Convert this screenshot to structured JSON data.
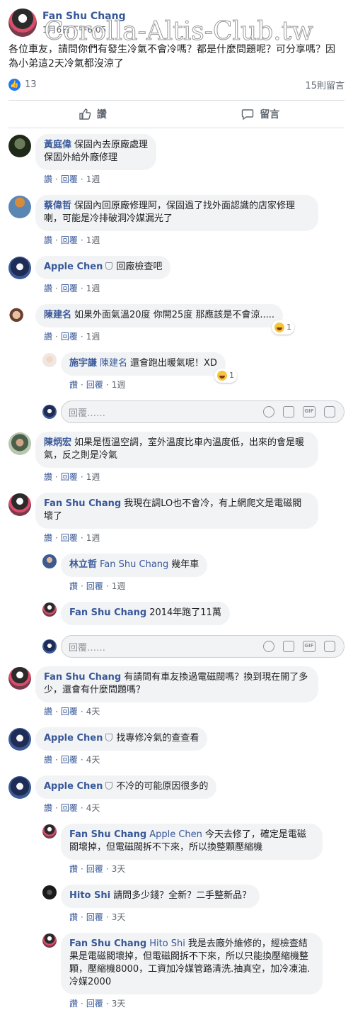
{
  "post": {
    "author": "Fan Shu Chang",
    "time": "1月6日下午6:05",
    "watermark": "Corolla-Altis-Club.tw",
    "text": "各位車友，請問你們有發生冷氣不會冷嗎？都是什麼問題呢？可分享嗎？因為小弟這2天冷氣都沒涼了",
    "like_count": "13",
    "comment_count": "15則留言",
    "like_label": "讚",
    "comment_label": "留言"
  },
  "common": {
    "like": "讚",
    "reply": "回覆",
    "reply_placeholder": "回覆……"
  },
  "comments": [
    {
      "author": "黃庭偉",
      "text": "保固內去原廠處理\n保固外給外廠修理",
      "age": "1週"
    },
    {
      "author": "蔡偉哲",
      "text": "保固內回原廠修理阿，保固過了找外面認識的店家修理喇，可能是冷排破洞冷媒漏光了",
      "age": "1週"
    },
    {
      "author": "Apple Chen",
      "text": "回廠檢查吧",
      "age": "1週"
    },
    {
      "author": "陳建名",
      "text": "如果外面氣溫20度 你開25度 那應該是不會涼.....",
      "age": "1週",
      "reaction_count": "1",
      "replies": [
        {
          "author": "施宇謙",
          "tag": "陳建名",
          "text": "還會跑出暖氣呢！XD",
          "age": "1週",
          "reaction_count": "1"
        }
      ]
    },
    {
      "author": "陳炳宏",
      "text": "如果是恆溫空調，室外溫度比車內溫度低，出來的會是暖氣，反之則是冷氣",
      "age": "1週"
    },
    {
      "author": "Fan Shu Chang",
      "text": "我現在調LO也不會冷，有上網爬文是電磁閥壞了",
      "age": "1週",
      "replies": [
        {
          "author": "林立哲",
          "tag": "Fan Shu Chang",
          "text": "幾年車",
          "age": "1週"
        },
        {
          "author": "Fan Shu Chang",
          "tag": "",
          "text": "2014年跑了11萬",
          "age": ""
        }
      ]
    },
    {
      "author": "Fan Shu Chang",
      "text": "有請問有車友換過電磁閥嗎？換到現在開了多少，還會有什麼問題嗎？",
      "age": "4天"
    },
    {
      "author": "Apple Chen",
      "text": "找專修冷氣的查查看",
      "age": "4天"
    },
    {
      "author": "Apple Chen",
      "text": "不冷的可能原因很多的",
      "age": "4天",
      "replies": [
        {
          "author": "Fan Shu Chang",
          "tag": "Apple Chen",
          "text": "今天去修了，確定是電磁閥壞掉，但電磁閥拆不下來，所以換整顆壓縮機",
          "age": "3天"
        },
        {
          "author": "Hito Shi",
          "tag": "",
          "text": "請問多少錢？全新？二手整新品？",
          "age": "3天"
        },
        {
          "author": "Fan Shu Chang",
          "tag": "Hito Shi",
          "text": "我是去廠外維修的，經檢查結果是電磁閥壞掉，但電磁閥拆不下來，所以只能換壓縮機整顆，壓縮機8000，工資加冷媒管路清洗.抽真空，加冷凍油.冷媒2000",
          "age": "3天"
        }
      ]
    }
  ]
}
